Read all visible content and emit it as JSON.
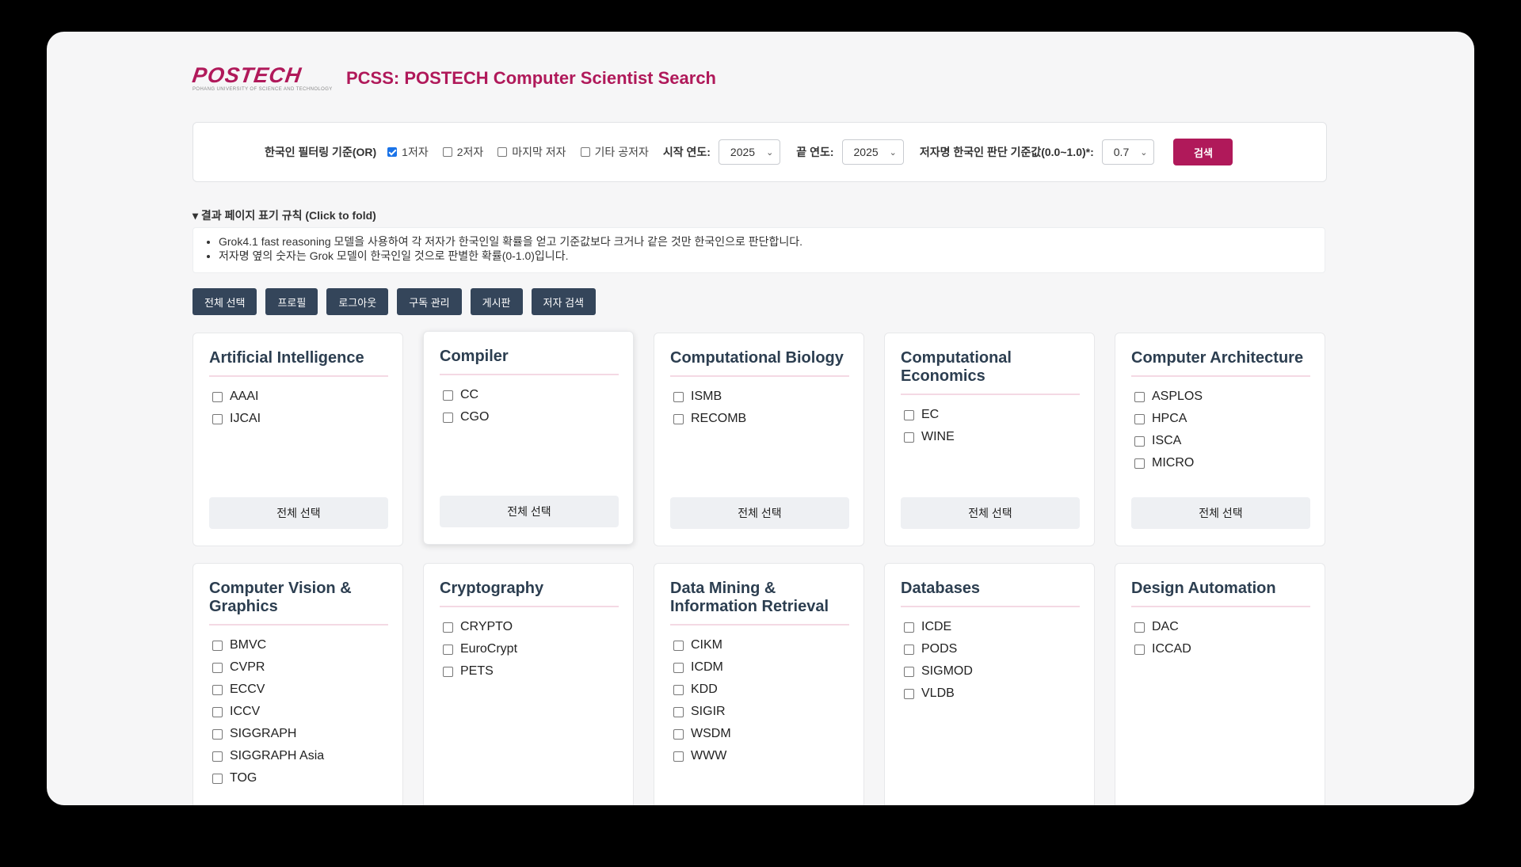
{
  "header": {
    "logo_text": "POSTECH",
    "logo_sub": "POHANG UNIVERSITY OF SCIENCE AND TECHNOLOGY",
    "title": "PCSS: POSTECH Computer Scientist Search"
  },
  "filter": {
    "label": "한국인 필터링 기준(OR)",
    "options": [
      {
        "label": "1저자",
        "checked": true
      },
      {
        "label": "2저자",
        "checked": false
      },
      {
        "label": "마지막 저자",
        "checked": false
      },
      {
        "label": "기타 공저자",
        "checked": false
      }
    ],
    "start_year_label": "시작 연도:",
    "start_year": "2025",
    "end_year_label": "끝 연도:",
    "end_year": "2025",
    "threshold_label": "저자명 한국인 판단 기준값(0.0~1.0)*:",
    "threshold": "0.7",
    "search_button": "검색"
  },
  "rules": {
    "toggle": "▾ 결과 페이지 표기 규칙 (Click to fold)",
    "items": [
      "Grok4.1 fast reasoning 모델을 사용하여 각 저자가 한국인일 확률을 얻고 기준값보다 크거나 같은 것만 한국인으로 판단합니다.",
      "저자명 옆의 숫자는 Grok 모델이 한국인일 것으로 판별한 확률(0-1.0)입니다."
    ]
  },
  "toolbar": [
    "전체 선택",
    "프로필",
    "로그아웃",
    "구독 관리",
    "게시판",
    "저자 검색"
  ],
  "select_all_label": "전체 선택",
  "cards": [
    {
      "title": "Artificial Intelligence",
      "confs": [
        "AAAI",
        "IJCAI"
      ]
    },
    {
      "title": "Compiler",
      "confs": [
        "CC",
        "CGO"
      ]
    },
    {
      "title": "Computational Biology",
      "confs": [
        "ISMB",
        "RECOMB"
      ]
    },
    {
      "title": "Computational Economics",
      "confs": [
        "EC",
        "WINE"
      ]
    },
    {
      "title": "Computer Architecture",
      "confs": [
        "ASPLOS",
        "HPCA",
        "ISCA",
        "MICRO"
      ]
    },
    {
      "title": "Computer Vision & Graphics",
      "confs": [
        "BMVC",
        "CVPR",
        "ECCV",
        "ICCV",
        "SIGGRAPH",
        "SIGGRAPH Asia",
        "TOG"
      ]
    },
    {
      "title": "Cryptography",
      "confs": [
        "CRYPTO",
        "EuroCrypt",
        "PETS"
      ]
    },
    {
      "title": "Data Mining & Information Retrieval",
      "confs": [
        "CIKM",
        "ICDM",
        "KDD",
        "SIGIR",
        "WSDM",
        "WWW"
      ]
    },
    {
      "title": "Databases",
      "confs": [
        "ICDE",
        "PODS",
        "SIGMOD",
        "VLDB"
      ]
    },
    {
      "title": "Design Automation",
      "confs": [
        "DAC",
        "ICCAD"
      ]
    }
  ]
}
